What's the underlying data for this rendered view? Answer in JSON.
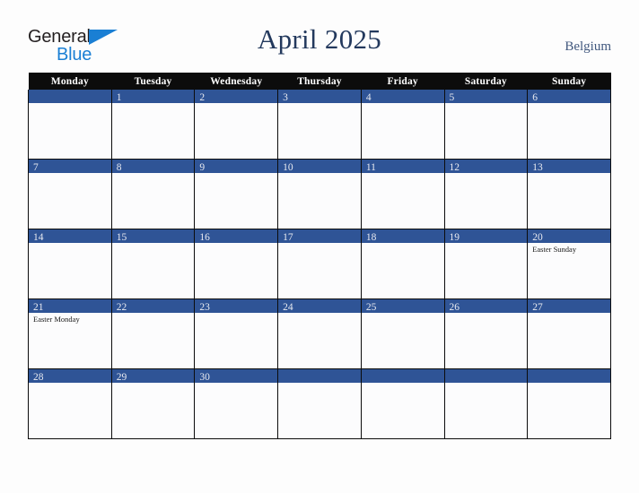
{
  "brand": {
    "name_line1": "General",
    "name_line2": "Blue",
    "triangle_icon": "triangle-icon",
    "color_dark": "#231f20",
    "color_blue": "#1a7fd4"
  },
  "header": {
    "title": "April 2025",
    "country": "Belgium",
    "title_color": "#23395d",
    "country_color": "#41587e"
  },
  "calendar": {
    "weekday_headers": [
      "Monday",
      "Tuesday",
      "Wednesday",
      "Thursday",
      "Friday",
      "Saturday",
      "Sunday"
    ],
    "header_bg": "#0c0c0c",
    "daybar_bg": "#2f5496",
    "cell_bg": "#fcfcfd",
    "weeks": [
      [
        {
          "day": "",
          "event": ""
        },
        {
          "day": "1",
          "event": ""
        },
        {
          "day": "2",
          "event": ""
        },
        {
          "day": "3",
          "event": ""
        },
        {
          "day": "4",
          "event": ""
        },
        {
          "day": "5",
          "event": ""
        },
        {
          "day": "6",
          "event": ""
        }
      ],
      [
        {
          "day": "7",
          "event": ""
        },
        {
          "day": "8",
          "event": ""
        },
        {
          "day": "9",
          "event": ""
        },
        {
          "day": "10",
          "event": ""
        },
        {
          "day": "11",
          "event": ""
        },
        {
          "day": "12",
          "event": ""
        },
        {
          "day": "13",
          "event": ""
        }
      ],
      [
        {
          "day": "14",
          "event": ""
        },
        {
          "day": "15",
          "event": ""
        },
        {
          "day": "16",
          "event": ""
        },
        {
          "day": "17",
          "event": ""
        },
        {
          "day": "18",
          "event": ""
        },
        {
          "day": "19",
          "event": ""
        },
        {
          "day": "20",
          "event": "Easter Sunday"
        }
      ],
      [
        {
          "day": "21",
          "event": "Easter Monday"
        },
        {
          "day": "22",
          "event": ""
        },
        {
          "day": "23",
          "event": ""
        },
        {
          "day": "24",
          "event": ""
        },
        {
          "day": "25",
          "event": ""
        },
        {
          "day": "26",
          "event": ""
        },
        {
          "day": "27",
          "event": ""
        }
      ],
      [
        {
          "day": "28",
          "event": ""
        },
        {
          "day": "29",
          "event": ""
        },
        {
          "day": "30",
          "event": ""
        },
        {
          "day": "",
          "event": ""
        },
        {
          "day": "",
          "event": ""
        },
        {
          "day": "",
          "event": ""
        },
        {
          "day": "",
          "event": ""
        }
      ]
    ]
  }
}
